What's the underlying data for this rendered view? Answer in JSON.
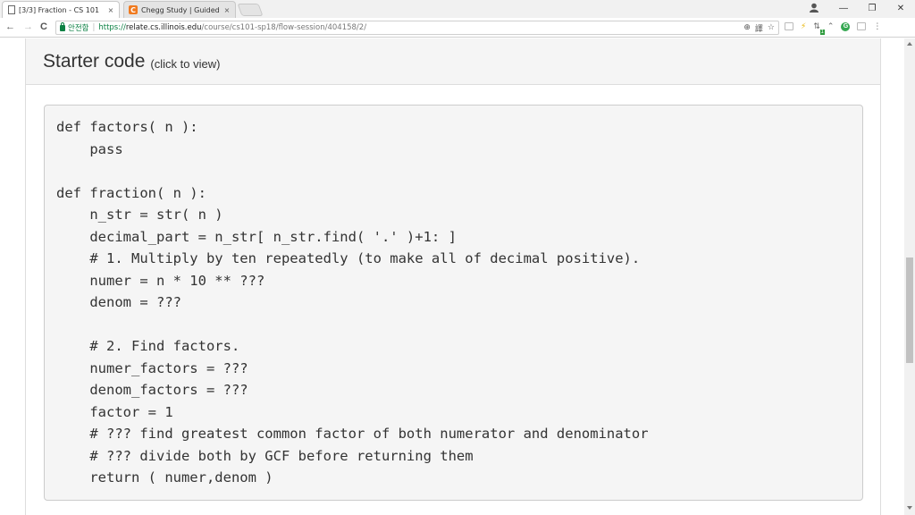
{
  "browser": {
    "tabs": [
      {
        "title": "[3/3] Fraction - CS 101",
        "close": "×"
      },
      {
        "title": "Chegg Study | Guided S",
        "favicon": "C",
        "close": "×"
      }
    ],
    "window_controls": {
      "minimize": "—",
      "restore": "❐",
      "close": "✕"
    },
    "nav": {
      "back": "←",
      "forward": "→",
      "reload": "C"
    },
    "address": {
      "secure_label": "안전함",
      "separator": "|",
      "scheme": "https://",
      "host": "relate.cs.illinois.edu",
      "path": "/course/cs101-sp18/flow-session/404158/2/"
    },
    "omnibox_icons": {
      "zoom": "⊕",
      "translate": "譯",
      "star": "☆"
    },
    "extensions": {
      "green_badge": "1",
      "grammarly": "G",
      "menu": "⋮"
    }
  },
  "panel": {
    "title": "Starter code",
    "hint": "(click to view)"
  },
  "code_lines": [
    "def factors( n ):",
    "    pass",
    "",
    "def fraction( n ):",
    "    n_str = str( n )",
    "    decimal_part = n_str[ n_str.find( '.' )+1: ]",
    "    # 1. Multiply by ten repeatedly (to make all of decimal positive).",
    "    numer = n * 10 ** ???",
    "    denom = ???",
    "",
    "    # 2. Find factors.",
    "    numer_factors = ???",
    "    denom_factors = ???",
    "    factor = 1",
    "    # ??? find greatest common factor of both numerator and denominator",
    "    # ??? divide both by GCF before returning them",
    "    return ( numer,denom )"
  ],
  "colors": {
    "secure_green": "#0b8043",
    "chegg_orange": "#f07a1f",
    "code_bg": "#f5f5f5",
    "heading_bg": "#f5f5f5"
  }
}
